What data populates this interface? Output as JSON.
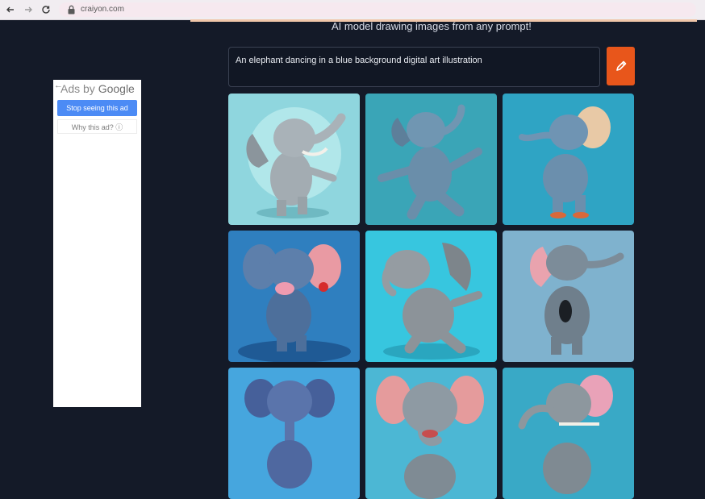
{
  "browser": {
    "url": "craiyon.com"
  },
  "page": {
    "subtitle": "AI model drawing images from any prompt!",
    "prompt_value": "An elephant dancing in a blue background digital art illustration"
  },
  "ad": {
    "ads_by": "Ads by",
    "brand": "Google",
    "stop_label": "Stop seeing this ad",
    "why_label": "Why this ad? ⓘ"
  },
  "colors": {
    "accent": "#e8561b",
    "background": "#141a28"
  },
  "icons": {
    "draw": "pencil-icon",
    "back": "back-arrow-icon",
    "forward": "forward-arrow-icon",
    "reload": "reload-icon",
    "lock": "lock-icon"
  }
}
